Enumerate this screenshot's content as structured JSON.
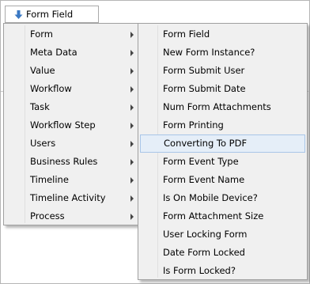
{
  "trigger": {
    "label": "Form Field",
    "icon": "down-arrow-icon"
  },
  "menu": {
    "items": [
      {
        "label": "Form",
        "has_submenu": true,
        "active": true
      },
      {
        "label": "Meta Data",
        "has_submenu": true
      },
      {
        "label": "Value",
        "has_submenu": true
      },
      {
        "label": "Workflow",
        "has_submenu": true
      },
      {
        "label": "Task",
        "has_submenu": true
      },
      {
        "label": "Workflow Step",
        "has_submenu": true
      },
      {
        "label": "Users",
        "has_submenu": true
      },
      {
        "label": "Business Rules",
        "has_submenu": true
      },
      {
        "label": "Timeline",
        "has_submenu": true
      },
      {
        "label": "Timeline Activity",
        "has_submenu": true
      },
      {
        "label": "Process",
        "has_submenu": true
      }
    ]
  },
  "submenu": {
    "items": [
      {
        "label": "Form Field"
      },
      {
        "label": "New Form Instance?"
      },
      {
        "label": "Form Submit User"
      },
      {
        "label": "Form Submit Date"
      },
      {
        "label": "Num Form Attachments"
      },
      {
        "label": "Form Printing"
      },
      {
        "label": "Converting To PDF",
        "highlighted": true
      },
      {
        "label": "Form Event Type"
      },
      {
        "label": "Form Event Name"
      },
      {
        "label": "Is On Mobile Device?"
      },
      {
        "label": "Form Attachment Size"
      },
      {
        "label": "User Locking Form"
      },
      {
        "label": "Date Form Locked"
      },
      {
        "label": "Is Form Locked?"
      }
    ]
  },
  "colors": {
    "accent_icon": "#3a78c3",
    "highlight_bg": "#e5eef8",
    "highlight_border": "#a9c6e8",
    "menu_bg": "#f0f0f0"
  }
}
